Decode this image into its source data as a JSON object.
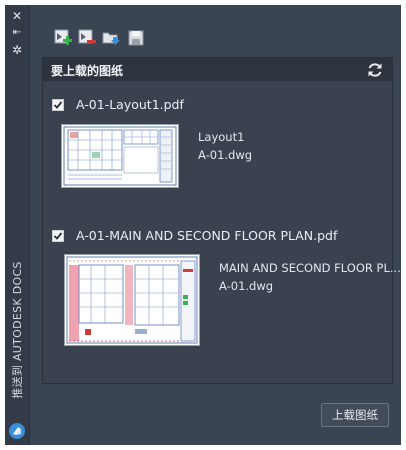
{
  "sidebar": {
    "close_glyph": "✕",
    "pin_glyph": "⇤",
    "settings_glyph": "✲",
    "title": "推送到 AUTODESK DOCS"
  },
  "toolbar": {
    "buttons": [
      "add-sheets-icon",
      "remove-sheets-icon",
      "open-folder-icon",
      "save-icon"
    ]
  },
  "panel": {
    "header_title": "要上载的图纸",
    "refresh_icon": "refresh-icon"
  },
  "items": [
    {
      "checked": true,
      "name": "A-01-Layout1.pdf",
      "layout": "Layout1",
      "file": "A-01.dwg"
    },
    {
      "checked": true,
      "name": "A-01-MAIN AND SECOND FLOOR PLAN.pdf",
      "layout": "MAIN AND SECOND FLOOR PL...",
      "file": "A-01.dwg"
    }
  ],
  "footer": {
    "upload_label": "上载图纸"
  },
  "colors": {
    "panel_bg": "#3b4453",
    "header_bg": "#2d343f",
    "accent_blue": "#3a8fd8",
    "add_green": "#36b34a",
    "remove_red": "#d23a3a"
  }
}
